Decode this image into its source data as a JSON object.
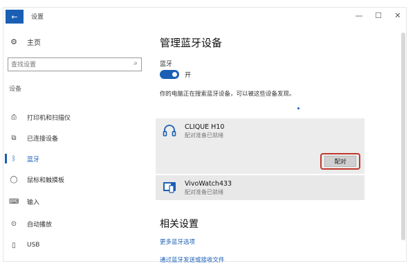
{
  "window": {
    "title": "设置",
    "back_icon": "back-arrow-icon",
    "controls": {
      "minimize": "—",
      "maximize": "☐",
      "close": "✕"
    }
  },
  "sidebar": {
    "home": {
      "icon": "gear-icon",
      "label": "主页"
    },
    "search": {
      "placeholder": "查找设置",
      "icon": "search-icon"
    },
    "section": "设备",
    "items": [
      {
        "icon": "printer-icon",
        "label": "打印机和扫描仪",
        "active": false
      },
      {
        "icon": "connected-devices-icon",
        "label": "已连接设备",
        "active": false
      },
      {
        "icon": "bluetooth-icon",
        "label": "蓝牙",
        "active": true
      },
      {
        "icon": "mouse-icon",
        "label": "鼠标和触摸板",
        "active": false
      },
      {
        "icon": "keyboard-icon",
        "label": "输入",
        "active": false
      },
      {
        "icon": "autoplay-icon",
        "label": "自动播放",
        "active": false
      },
      {
        "icon": "usb-icon",
        "label": "USB",
        "active": false
      }
    ]
  },
  "main": {
    "title": "管理蓝牙设备",
    "bluetooth_label": "蓝牙",
    "toggle_state": "开",
    "discover_text": "你的电脑正在搜索蓝牙设备，可以被这些设备发现。",
    "devices": [
      {
        "name": "CLIQUE H10",
        "status": "配对准备已就绪",
        "icon": "headset-icon"
      },
      {
        "name": "VivoWatch433",
        "status": "配对准备已就绪",
        "icon": "device-icon"
      }
    ],
    "pair_button": "配对",
    "related": {
      "title": "相关设置",
      "links": [
        "更多蓝牙选项",
        "通过蓝牙发送或接收文件"
      ]
    }
  },
  "colors": {
    "accent": "#1a5fb4",
    "highlight_border": "#c0392b",
    "device_panel": "#ececec"
  }
}
